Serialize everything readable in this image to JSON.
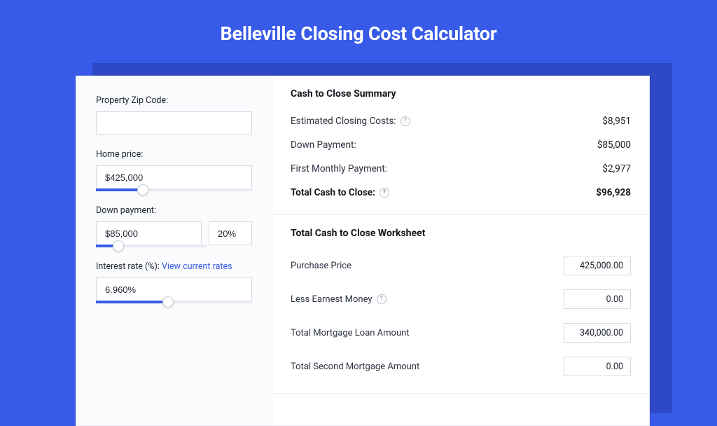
{
  "page": {
    "title": "Belleville Closing Cost Calculator"
  },
  "left": {
    "zip": {
      "label": "Property Zip Code:",
      "value": ""
    },
    "price": {
      "label": "Home price:",
      "value": "$425,000",
      "slider": {
        "percent": 30
      }
    },
    "down": {
      "label": "Down payment:",
      "value": "$85,000",
      "pct": "20%",
      "slider": {
        "percent": 20
      }
    },
    "rate": {
      "label": "Interest rate (%):",
      "link": "View current rates",
      "value": "6.960%",
      "slider": {
        "percent": 46
      }
    }
  },
  "summary": {
    "title": "Cash to Close Summary",
    "rows": {
      "closing": {
        "label": "Estimated Closing Costs:",
        "value": "$8,951",
        "help": true
      },
      "down": {
        "label": "Down Payment:",
        "value": "$85,000"
      },
      "first": {
        "label": "First Monthly Payment:",
        "value": "$2,977"
      },
      "total": {
        "label": "Total Cash to Close:",
        "value": "$96,928",
        "help": true
      }
    }
  },
  "worksheet": {
    "title": "Total Cash to Close Worksheet",
    "rows": {
      "purchase": {
        "label": "Purchase Price",
        "value": "425,000.00"
      },
      "earnest": {
        "label": "Less Earnest Money",
        "value": "0.00",
        "help": true
      },
      "loan": {
        "label": "Total Mortgage Loan Amount",
        "value": "340,000.00"
      },
      "second": {
        "label": "Total Second Mortgage Amount",
        "value": "0.00"
      }
    }
  }
}
